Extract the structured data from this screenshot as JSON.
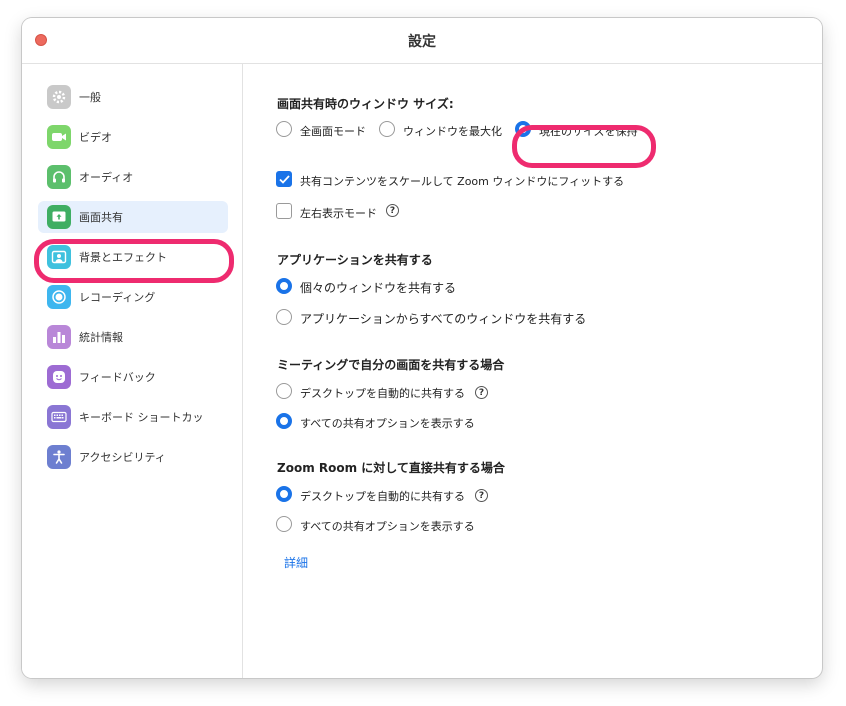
{
  "window": {
    "title": "設定"
  },
  "sidebar": {
    "items": [
      {
        "label": "一般",
        "icon": "gear-icon",
        "color": "#c9c9c9"
      },
      {
        "label": "ビデオ",
        "icon": "video-camera-icon",
        "color": "#7ed66b"
      },
      {
        "label": "オーディオ",
        "icon": "headphones-icon",
        "color": "#5cbf6c"
      },
      {
        "label": "画面共有",
        "icon": "screen-share-icon",
        "color": "#3fae63",
        "selected": true
      },
      {
        "label": "背景とエフェクト",
        "icon": "background-person-icon",
        "color": "#3fc1de"
      },
      {
        "label": "レコーディング",
        "icon": "record-icon",
        "color": "#3eb6ef"
      },
      {
        "label": "統計情報",
        "icon": "bar-chart-icon",
        "color": "#b987d8"
      },
      {
        "label": "フィードバック",
        "icon": "smile-icon",
        "color": "#9d6bd3"
      },
      {
        "label": "キーボード ショートカッ",
        "icon": "keyboard-icon",
        "color": "#8a76d4"
      },
      {
        "label": "アクセシビリティ",
        "icon": "accessibility-icon",
        "color": "#6d7fd0"
      }
    ]
  },
  "main": {
    "window_size": {
      "title": "画面共有時のウィンドウ サイズ:",
      "options": [
        "全画面モード",
        "ウィンドウを最大化",
        "現在のサイズを保持"
      ],
      "selected": 2,
      "scale_label": "共有コンテンツをスケールして Zoom ウィンドウにフィットする",
      "scale_checked": true,
      "side_by_side_label": "左右表示モード",
      "side_by_side_checked": false
    },
    "share_app": {
      "title": "アプリケーションを共有する",
      "options": [
        "個々のウィンドウを共有する",
        "アプリケーションからすべてのウィンドウを共有する"
      ],
      "selected": 0
    },
    "meeting_share": {
      "title": "ミーティングで自分の画面を共有する場合",
      "options": [
        "デスクトップを自動的に共有する",
        "すべての共有オプションを表示する"
      ],
      "selected": 1
    },
    "zoom_room": {
      "title": "Zoom Room に対して直接共有する場合",
      "options": [
        "デスクトップを自動的に共有する",
        "すべての共有オプションを表示する"
      ],
      "selected": 0
    },
    "details_link": "詳細",
    "help_glyph": "?"
  }
}
